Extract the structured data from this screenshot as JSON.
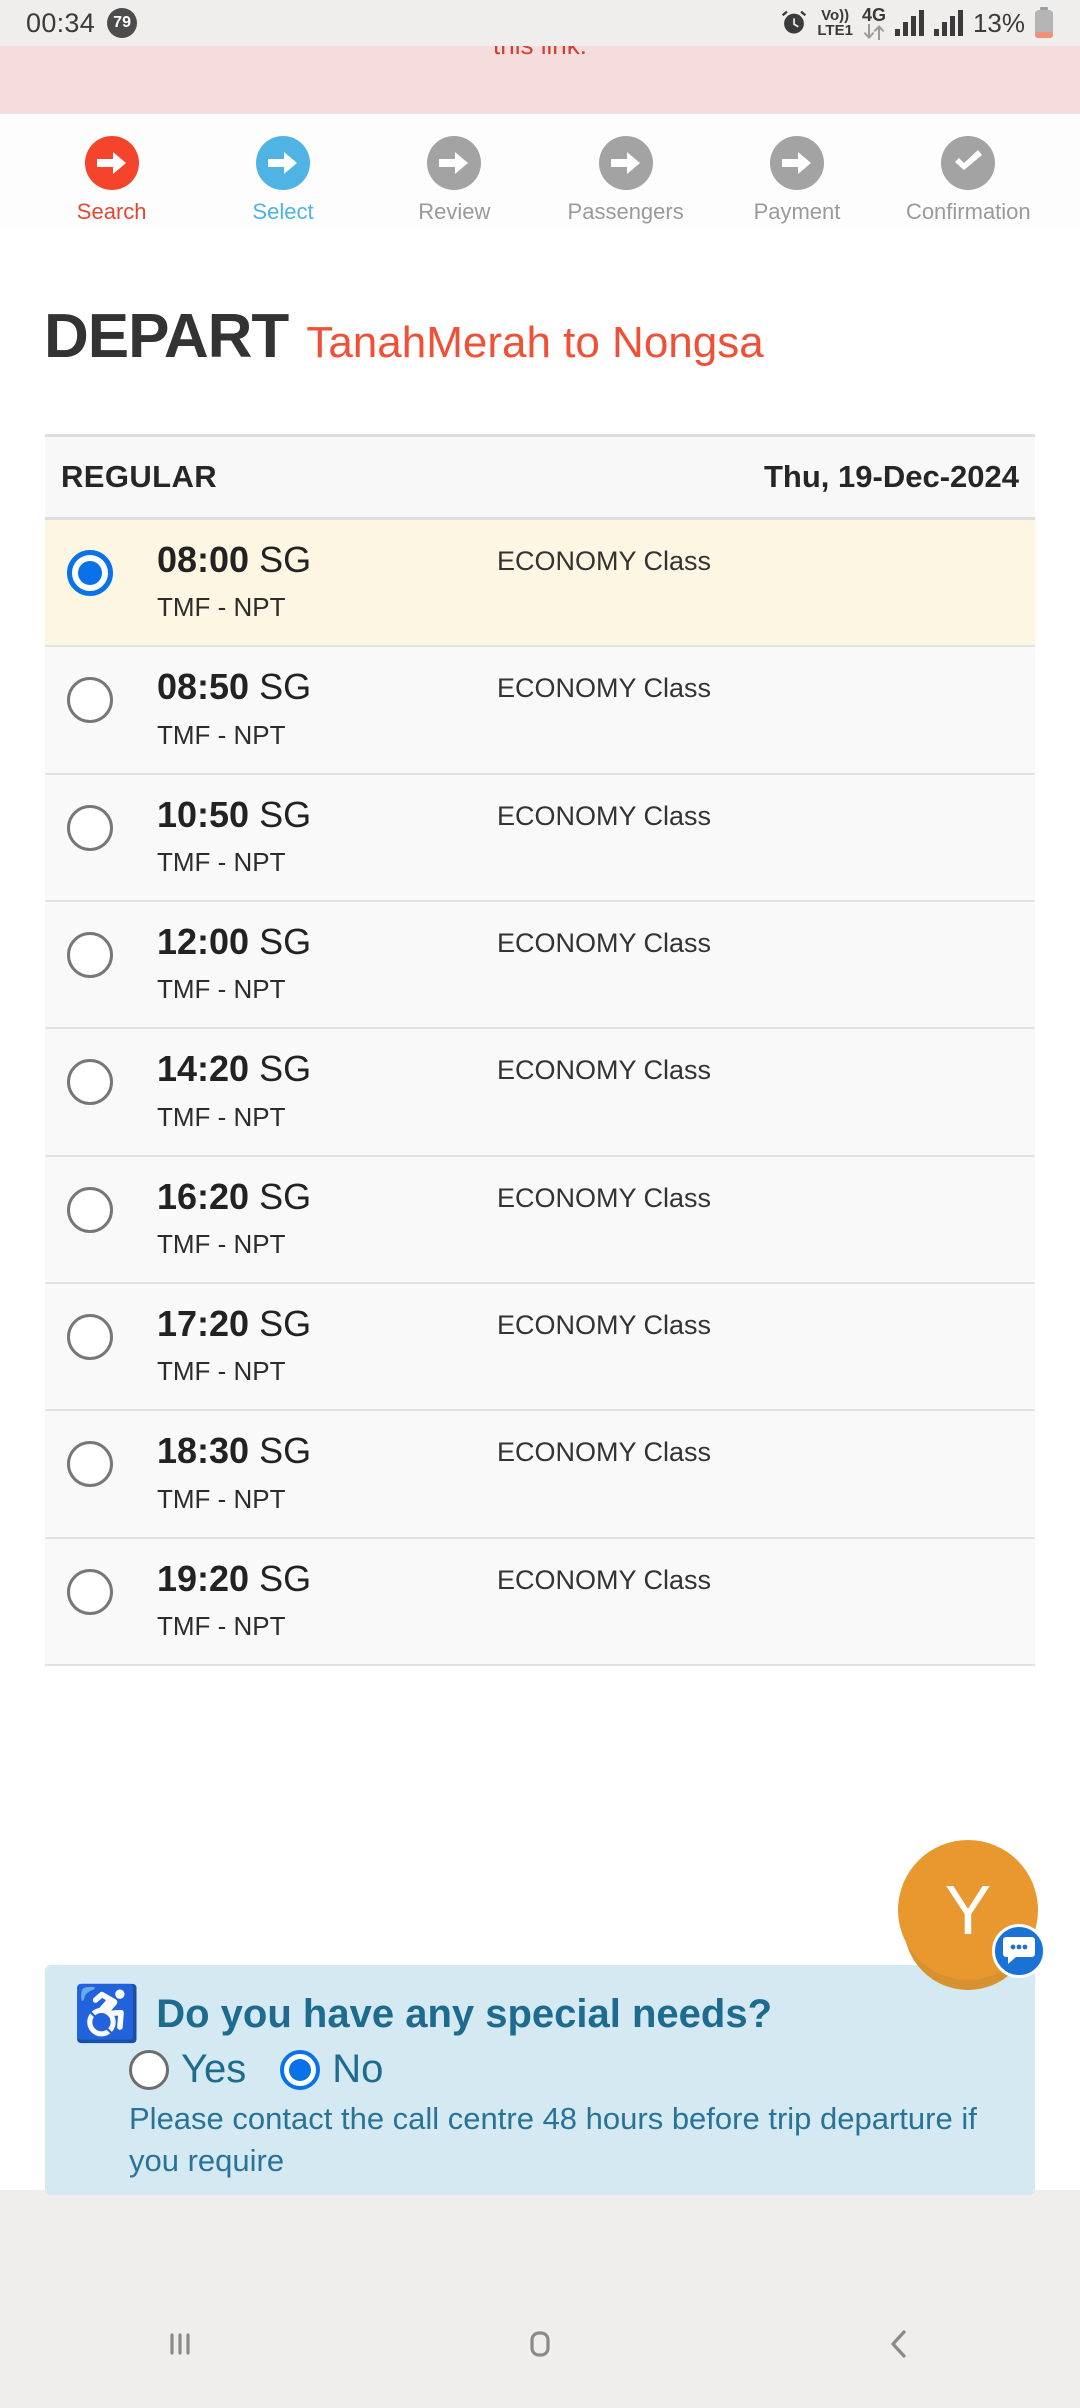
{
  "status_bar": {
    "clock": "00:34",
    "notification_count": "79",
    "alarm_icon": "alarm-icon",
    "volte_line1": "Vo))",
    "volte_line2": "LTE1",
    "network_type": "4G",
    "data_arrows": "data-transfer-icon",
    "signal_1": "signal-bars-icon",
    "signal_2": "signal-bars-icon",
    "battery_percent": "13%",
    "battery_icon": "battery-icon"
  },
  "notice": {
    "text": "this link."
  },
  "stepper": {
    "steps": [
      {
        "label": "Search",
        "state": "done",
        "icon": "arrow-right-icon"
      },
      {
        "label": "Select",
        "state": "current",
        "icon": "arrow-right-icon"
      },
      {
        "label": "Review",
        "state": "pending",
        "icon": "arrow-right-icon"
      },
      {
        "label": "Passengers",
        "state": "pending",
        "icon": "arrow-right-icon"
      },
      {
        "label": "Payment",
        "state": "pending",
        "icon": "arrow-right-icon"
      },
      {
        "label": "Confirmation",
        "state": "pending",
        "icon": "check-icon"
      }
    ]
  },
  "heading": {
    "main": "DEPART",
    "sub": "TanahMerah to Nongsa"
  },
  "schedule": {
    "header": {
      "fare_type": "REGULAR",
      "date": "Thu, 19-Dec-2024"
    },
    "rows": [
      {
        "time": "08:00",
        "zone": "SG",
        "route": "TMF - NPT",
        "class": "ECONOMY Class",
        "selected": true
      },
      {
        "time": "08:50",
        "zone": "SG",
        "route": "TMF - NPT",
        "class": "ECONOMY Class",
        "selected": false
      },
      {
        "time": "10:50",
        "zone": "SG",
        "route": "TMF - NPT",
        "class": "ECONOMY Class",
        "selected": false
      },
      {
        "time": "12:00",
        "zone": "SG",
        "route": "TMF - NPT",
        "class": "ECONOMY Class",
        "selected": false
      },
      {
        "time": "14:20",
        "zone": "SG",
        "route": "TMF - NPT",
        "class": "ECONOMY Class",
        "selected": false
      },
      {
        "time": "16:20",
        "zone": "SG",
        "route": "TMF - NPT",
        "class": "ECONOMY Class",
        "selected": false
      },
      {
        "time": "17:20",
        "zone": "SG",
        "route": "TMF - NPT",
        "class": "ECONOMY Class",
        "selected": false
      },
      {
        "time": "18:30",
        "zone": "SG",
        "route": "TMF - NPT",
        "class": "ECONOMY Class",
        "selected": false
      },
      {
        "time": "19:20",
        "zone": "SG",
        "route": "TMF - NPT",
        "class": "ECONOMY Class",
        "selected": false
      }
    ]
  },
  "special_needs": {
    "icon": "wheelchair-icon",
    "question": "Do you have any special needs?",
    "yes_label": "Yes",
    "no_label": "No",
    "selected": "No",
    "note": "Please contact the call centre 48 hours before trip departure if you require"
  },
  "chat_widget": {
    "letter": "Y",
    "badge_icon": "chat-bubble-icon"
  },
  "nav_bar": {
    "recents_icon": "recents-icon",
    "home_icon": "home-icon",
    "back_icon": "back-icon"
  },
  "colors": {
    "accent_orange": "#ef5036",
    "step_done": "#f4442b",
    "step_current": "#4fb4e4",
    "step_pending": "#a3a3a3",
    "selected_row": "#fcf6e2",
    "notice_bg": "#f6dddd",
    "notice_text": "#d2412f",
    "special_bg": "#d4e9f2",
    "special_text": "#1d6b8f",
    "radio_blue": "#0a72e8",
    "fab_orange": "#e8982f",
    "fab_badge_blue": "#1a73d4"
  }
}
